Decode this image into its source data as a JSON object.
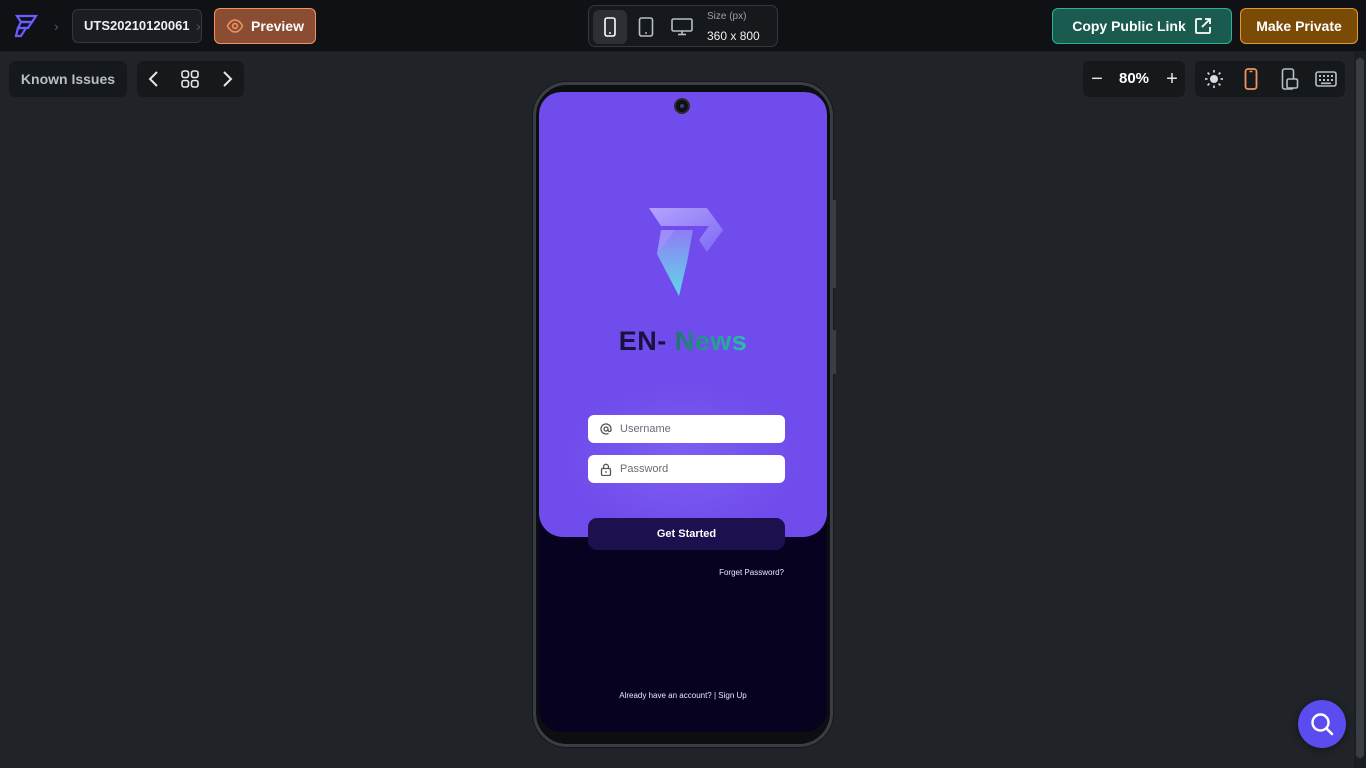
{
  "header": {
    "project_id": "UTS20210120061",
    "preview_label": "Preview",
    "device_size_label": "Size (px)",
    "device_size_value": "360 x 800",
    "copy_link_label": "Copy Public Link",
    "make_private_label": "Make Private"
  },
  "toolbar": {
    "known_issues_label": "Known Issues",
    "zoom_value": "80%",
    "zoom_minus": "−",
    "zoom_plus": "+"
  },
  "app": {
    "title_part1": "EN-",
    "title_part2": " News",
    "username_placeholder": "Username",
    "password_placeholder": "Password",
    "get_started_label": "Get Started",
    "forget_password_label": "Forget Password?",
    "signup_prompt": "Already have an account? | Sign Up"
  },
  "colors": {
    "accent_preview": "#f0945e",
    "accent_copy": "#2bb39a",
    "accent_private": "#e09a2f",
    "app_primary": "#704cec",
    "app_dark": "#07021f",
    "help_fab": "#5b4cf0"
  },
  "icons": {
    "logo": "brand-logo-icon",
    "chevron": "chevron-right-icon",
    "preview": "eye-icon",
    "phone": "phone-icon",
    "tablet": "tablet-icon",
    "desktop": "desktop-icon",
    "external": "external-link-icon",
    "prev": "chevron-left-icon",
    "grid": "grid-icon",
    "next": "chevron-right-icon",
    "theme": "sun-icon",
    "portrait": "phone-portrait-icon",
    "rotate": "device-rotate-icon",
    "keyboard": "keyboard-icon",
    "at": "at-icon",
    "lock": "lock-icon",
    "help": "search-help-icon"
  }
}
